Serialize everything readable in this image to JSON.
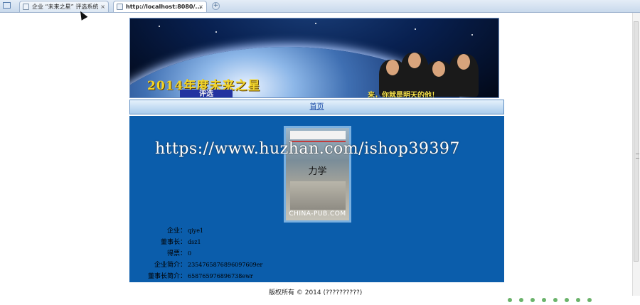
{
  "browser": {
    "tabs": [
      {
        "label": "企业 “未来之星” 评选系统",
        "close": "×",
        "active": false
      },
      {
        "label": "http://localhost:8080/...",
        "close": "×",
        "active": true
      }
    ],
    "new_tab": "+"
  },
  "banner": {
    "title": "2014年度未来之星",
    "sub": "评选",
    "slogan": "来，你就是明天的他！"
  },
  "nav": {
    "home": "首页"
  },
  "product": {
    "book_title": "力学",
    "book_caption": "CHINA-PUB.COM"
  },
  "watermark": "https://www.huzhan.com/ishop39397",
  "info": [
    {
      "label": "企业：",
      "value": "qiye1"
    },
    {
      "label": "董事长：",
      "value": "dsz1"
    },
    {
      "label": "得票：",
      "value": "0"
    },
    {
      "label": "企业简介：",
      "value": "23547658768960976​09er"
    },
    {
      "label": "董事长简介：",
      "value": "658765976896738ewr"
    }
  ],
  "footer": "版权所有 © 2014 (??????????)",
  "colors": {
    "content_bg": "#0b5dab",
    "nav_link": "#1f4fa8",
    "banner_text": "#f2d52a"
  }
}
